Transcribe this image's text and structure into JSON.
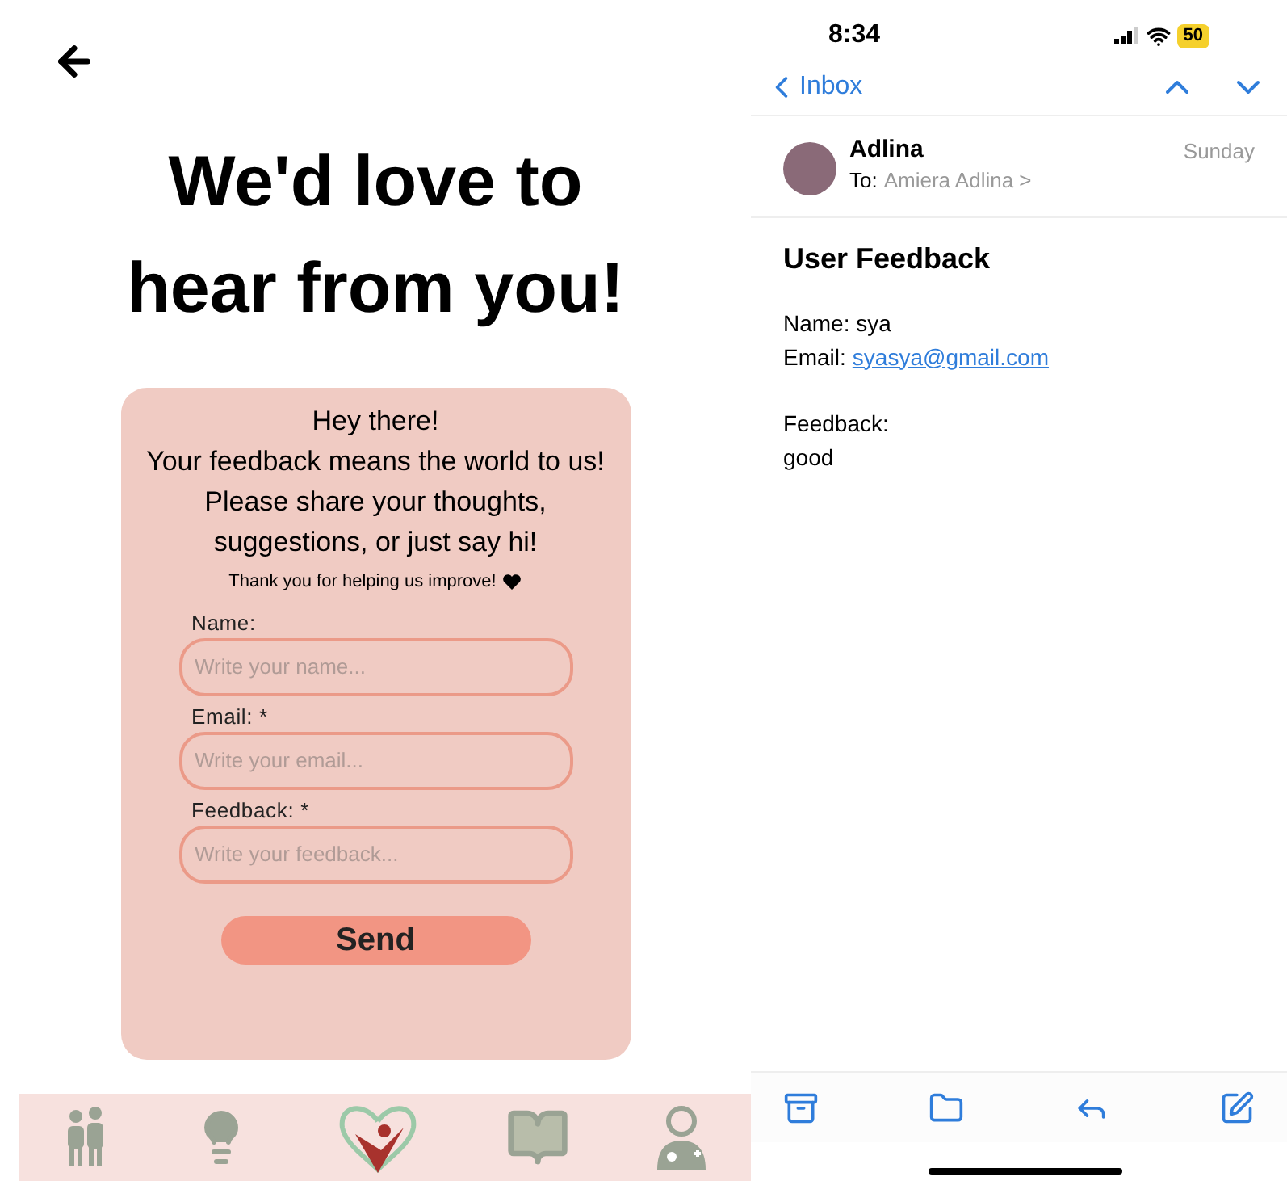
{
  "app": {
    "title_lines": [
      "We'd love to",
      "hear from you!"
    ],
    "card": {
      "intro_lines": [
        "Hey there!",
        "Your feedback means the world to us!",
        "Please share your thoughts,",
        "suggestions, or just say hi!"
      ],
      "thanks": "Thank you for helping us improve!",
      "fields": [
        {
          "label": "Name:",
          "placeholder": "Write your name..."
        },
        {
          "label": "Email: *",
          "placeholder": "Write your email..."
        },
        {
          "label": "Feedback: *",
          "placeholder": "Write your feedback..."
        }
      ],
      "send": "Send"
    },
    "nav": [
      {
        "kind": "people",
        "selected": false
      },
      {
        "kind": "idea",
        "selected": false
      },
      {
        "kind": "logo",
        "selected": true
      },
      {
        "kind": "book",
        "selected": false
      },
      {
        "kind": "doctor",
        "selected": false
      }
    ]
  },
  "mail": {
    "status": {
      "time": "8:34",
      "battery": "50"
    },
    "back": "Inbox",
    "sender": "Adlina",
    "to_label": "To:",
    "to": "Amiera Adlina >",
    "date": "Sunday",
    "subject": "User Feedback",
    "name_line": "Name: sya",
    "email_label": "Email:",
    "email": "syasya@gmail.com",
    "feedback_label": "Feedback:",
    "feedback": "good"
  }
}
